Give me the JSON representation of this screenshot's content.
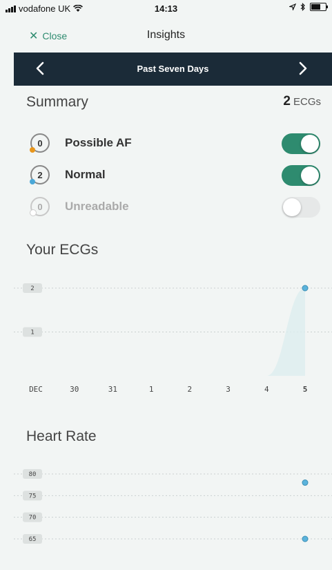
{
  "status": {
    "carrier": "vodafone UK",
    "time": "14:13"
  },
  "nav": {
    "close_label": "Close",
    "title": "Insights"
  },
  "period": {
    "title": "Past Seven Days"
  },
  "summary": {
    "title": "Summary",
    "count": "2",
    "count_unit": "ECGs",
    "rows": [
      {
        "count": "0",
        "label": "Possible AF",
        "enabled": true,
        "dot_color": "#e8961c"
      },
      {
        "count": "2",
        "label": "Normal",
        "enabled": true,
        "dot_color": "#4aa8d8"
      },
      {
        "count": "0",
        "label": "Unreadable",
        "enabled": false,
        "dot_color": "#ffffff"
      }
    ]
  },
  "colors": {
    "accent": "#2e8b6f",
    "header": "#1b2b38",
    "point": "#5bb3dc",
    "highlight_day": "#38a9d9"
  },
  "ecg_section": {
    "title": "Your ECGs"
  },
  "heart_section": {
    "title": "Heart Rate"
  },
  "chart_data": [
    {
      "type": "area",
      "title": "Your ECGs",
      "categories": [
        "DEC",
        "30",
        "31",
        "1",
        "2",
        "3",
        "4",
        "5"
      ],
      "values": [
        0,
        0,
        0,
        0,
        0,
        0,
        0,
        2
      ],
      "yticks": [
        1,
        2
      ],
      "ylim": [
        0,
        2
      ],
      "highlight": "5"
    },
    {
      "type": "scatter",
      "title": "Heart Rate",
      "yticks": [
        65,
        70,
        75,
        80
      ],
      "ylim": [
        65,
        80
      ],
      "points": [
        {
          "x": "5",
          "y": 78
        },
        {
          "x": "5",
          "y": 65
        }
      ]
    }
  ]
}
